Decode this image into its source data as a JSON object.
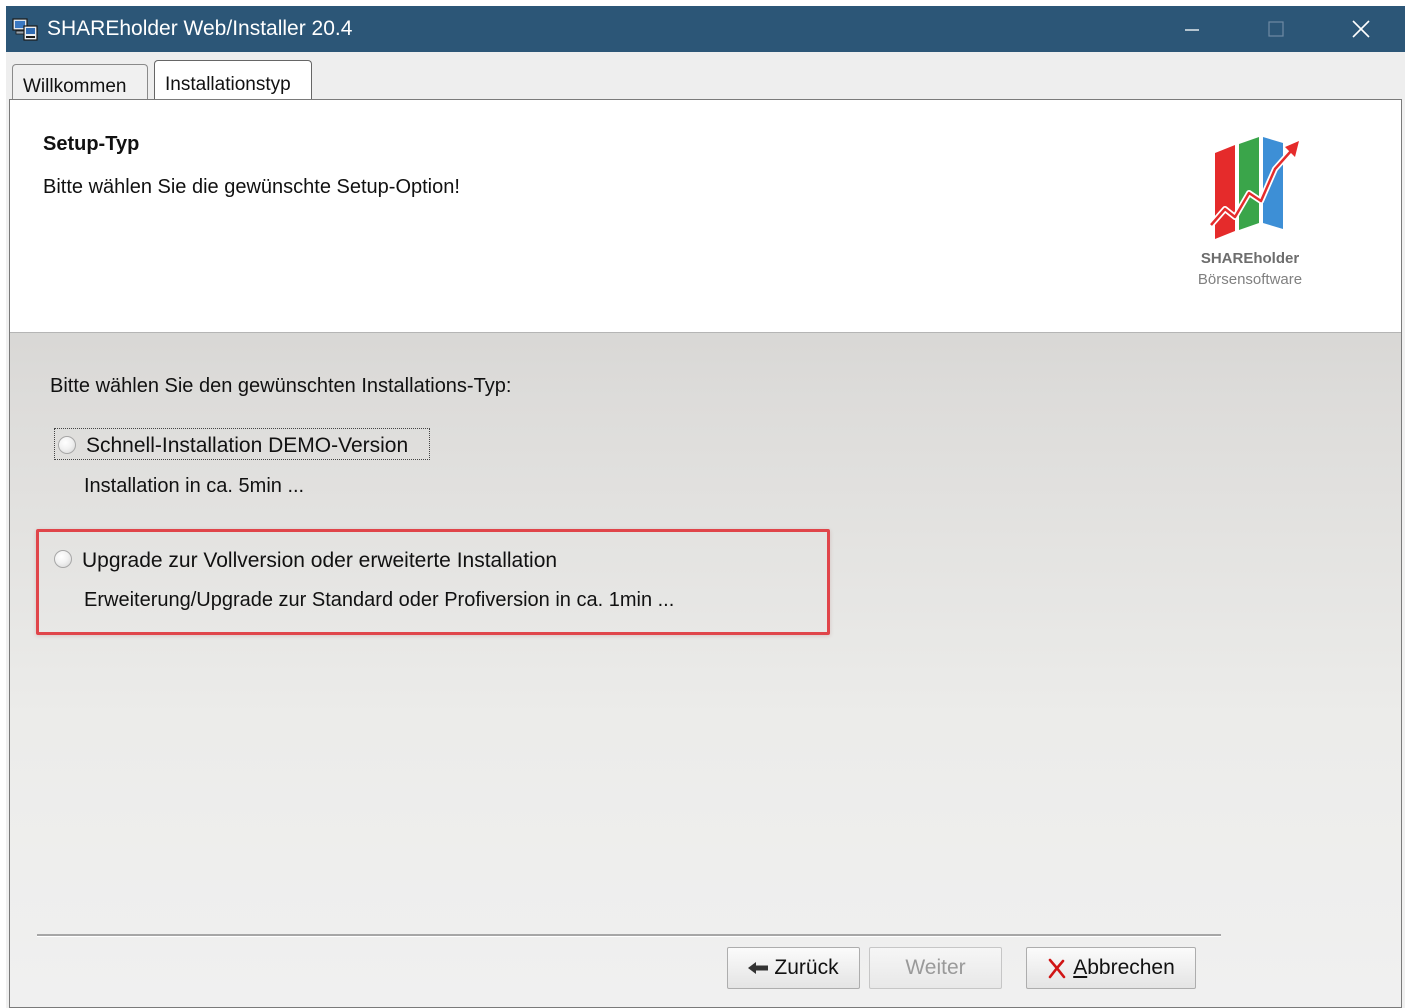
{
  "window": {
    "title": "SHAREholder Web/Installer 20.4",
    "icons": {
      "app": "installer-computer-icon",
      "minimize": "minimize-icon",
      "maximize": "maximize-icon",
      "close": "close-icon"
    }
  },
  "tabs": [
    {
      "label": "Willkommen",
      "active": false
    },
    {
      "label": "Installationstyp",
      "active": true
    }
  ],
  "header": {
    "title": "Setup-Typ",
    "subtitle": "Bitte wählen Sie die gewünschte Setup-Option!",
    "logo_name": "SHAREholder",
    "logo_tagline": "Börsensoftware",
    "logo_colors": [
      "#e52b2b",
      "#3aa54a",
      "#3d8fd6"
    ]
  },
  "main": {
    "prompt": "Bitte wählen Sie den gewünschten Installations-Typ:",
    "options": [
      {
        "label": "Schnell-Installation DEMO-Version",
        "description": "Installation in ca. 5min ...",
        "selected": false,
        "focused": true
      },
      {
        "label": "Upgrade zur Vollversion oder erweiterte Installation",
        "description": "Erweiterung/Upgrade zur Standard oder Profiversion in ca. 1min ...",
        "selected": false,
        "highlighted": true
      }
    ],
    "highlight_color": "#e0454a"
  },
  "buttons": {
    "back": {
      "label": "Zurück",
      "icon": "arrow-left-icon",
      "enabled": true
    },
    "next": {
      "label": "Weiter",
      "enabled": false
    },
    "cancel": {
      "label_access": "A",
      "label_rest": "bbrechen",
      "icon": "red-x-icon",
      "enabled": true
    }
  }
}
